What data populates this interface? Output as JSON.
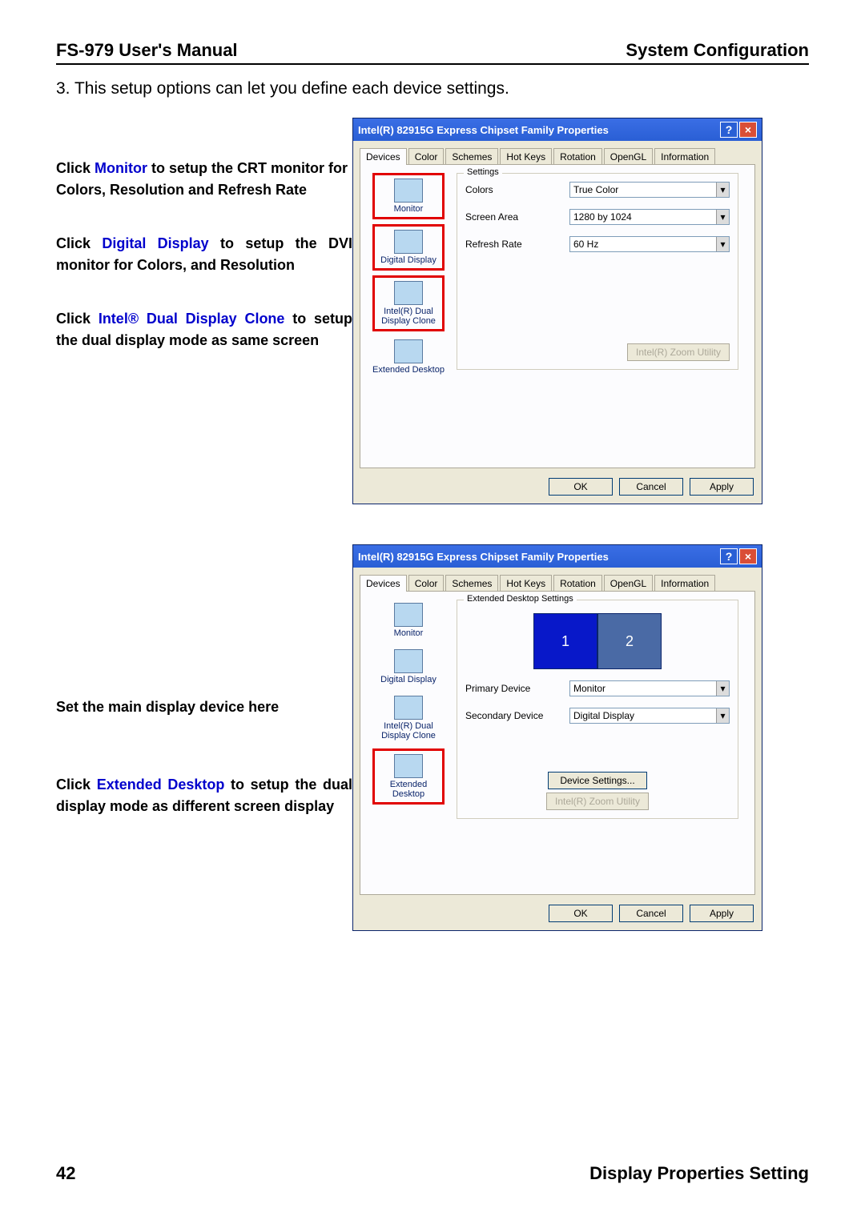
{
  "header": {
    "left": "FS-979 User's Manual",
    "right": "System Configuration"
  },
  "intro": "3. This setup options can let you define each device settings.",
  "anno1": {
    "a1_pre": "Click ",
    "a1_blue": "Monitor",
    "a1_post": " to setup the CRT monitor for Colors, Resolution and Refresh Rate",
    "a2_pre": "Click ",
    "a2_blue": "Digital Display",
    "a2_post": " to setup the DVI monitor for Colors, and Resolution",
    "a3_pre": "Click ",
    "a3_blue": "Intel® Dual Display Clone",
    "a3_post": " to setup the dual display mode as same screen"
  },
  "anno2": {
    "b1": "Set the main display device here",
    "b2_pre": "Click ",
    "b2_blue": "Extended Desktop",
    "b2_post": " to setup the dual display mode as different screen display"
  },
  "dialog": {
    "title": "Intel(R) 82915G Express Chipset Family Properties",
    "tabs": [
      "Devices",
      "Color",
      "Schemes",
      "Hot Keys",
      "Rotation",
      "OpenGL",
      "Information"
    ],
    "devices": {
      "monitor": "Monitor",
      "digital": "Digital Display",
      "clone": "Intel(R) Dual Display Clone",
      "extended": "Extended Desktop"
    },
    "settings": {
      "legend": "Settings",
      "colors_lbl": "Colors",
      "colors_val": "True Color",
      "screen_lbl": "Screen Area",
      "screen_val": "1280 by 1024",
      "refresh_lbl": "Refresh Rate",
      "refresh_val": "60 Hz",
      "zoom": "Intel(R) Zoom Utility"
    },
    "extended_settings": {
      "legend": "Extended Desktop Settings",
      "m1": "1",
      "m2": "2",
      "primary_lbl": "Primary Device",
      "primary_val": "Monitor",
      "secondary_lbl": "Secondary Device",
      "secondary_val": "Digital Display",
      "device_settings": "Device Settings...",
      "zoom": "Intel(R) Zoom Utility"
    },
    "buttons": {
      "ok": "OK",
      "cancel": "Cancel",
      "apply": "Apply"
    }
  },
  "footer": {
    "page": "42",
    "section": "Display Properties Setting"
  }
}
